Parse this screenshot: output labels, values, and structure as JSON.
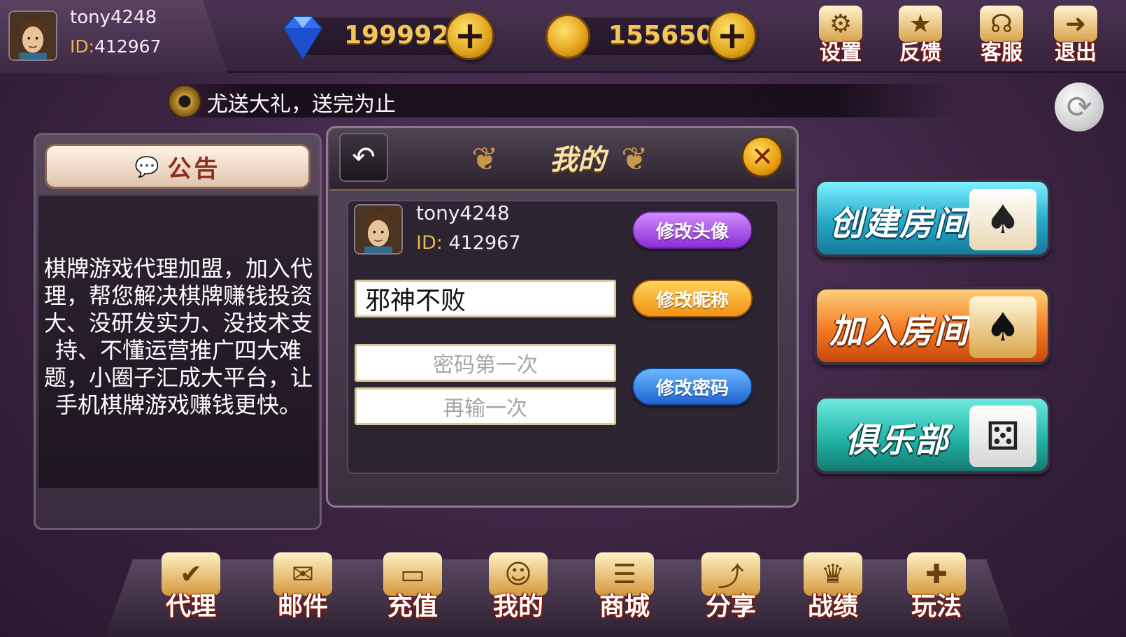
{
  "user": {
    "name": "tony4248",
    "id_prefix": "ID:",
    "id_value": "412967"
  },
  "currency": {
    "diamonds": "199992",
    "gold": "155650",
    "plus": "+"
  },
  "top_menu": [
    {
      "label": "设置",
      "icon": "gear-icon"
    },
    {
      "label": "反馈",
      "icon": "feedback-icon"
    },
    {
      "label": "客服",
      "icon": "headset-icon"
    },
    {
      "label": "退出",
      "icon": "exit-icon"
    }
  ],
  "marquee": {
    "text": "尤送大礼，送完为止"
  },
  "notice": {
    "title": "公告",
    "body": "棋牌游戏代理加盟，加入代理，帮您解决棋牌赚钱投资大、没研发实力、没技术支持、不懂运营推广四大难题，小圈子汇成大平台，让手机棋牌游戏赚钱更快。"
  },
  "mine_panel": {
    "title": "我的",
    "username": "tony4248",
    "id_prefix": "ID:",
    "id_value": "412967",
    "change_avatar": "修改头像",
    "nickname_value": "邪神不败",
    "change_nickname": "修改昵称",
    "password_placeholder": "密码第一次",
    "password_repeat_placeholder": "再输一次",
    "change_password": "修改密码"
  },
  "room_buttons": {
    "create": "创建房间",
    "join": "加入房间",
    "club": "俱乐部"
  },
  "bottom_nav": [
    {
      "label": "代理",
      "icon": "agent-icon"
    },
    {
      "label": "邮件",
      "icon": "mail-icon"
    },
    {
      "label": "充值",
      "icon": "recharge-icon"
    },
    {
      "label": "我的",
      "icon": "profile-icon"
    },
    {
      "label": "商城",
      "icon": "shop-cart-icon"
    },
    {
      "label": "分享",
      "icon": "share-icon"
    },
    {
      "label": "战绩",
      "icon": "trophy-icon"
    },
    {
      "label": "玩法",
      "icon": "gamepad-icon"
    }
  ],
  "colors": {
    "accent_gold": "#f1c65a",
    "id_label": "#e8b64a",
    "background": "#3b2442"
  }
}
